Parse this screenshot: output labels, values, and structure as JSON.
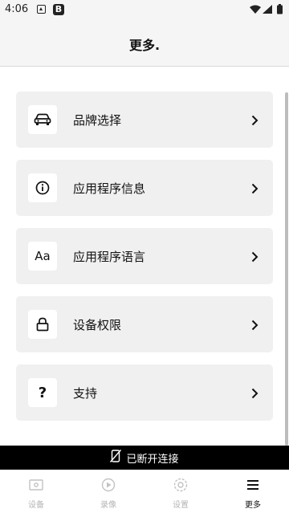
{
  "status_bar": {
    "time": "4:06",
    "notification_badge": "B"
  },
  "header": {
    "title": "更多."
  },
  "menu": [
    {
      "label": "品牌选择",
      "icon": "car-icon"
    },
    {
      "label": "应用程序信息",
      "icon": "info-icon"
    },
    {
      "label": "应用程序语言",
      "icon": "font-icon",
      "icon_text": "Aa"
    },
    {
      "label": "设备权限",
      "icon": "lock-icon"
    },
    {
      "label": "支持",
      "icon": "help-icon",
      "icon_text": "?"
    }
  ],
  "banner": {
    "text": "已断开连接",
    "icon": "no-phone-icon"
  },
  "bottom_nav": [
    {
      "label": "设备",
      "icon": "device-icon",
      "active": false
    },
    {
      "label": "录像",
      "icon": "play-icon",
      "active": false
    },
    {
      "label": "设置",
      "icon": "gear-icon",
      "active": false
    },
    {
      "label": "更多",
      "icon": "menu-icon",
      "active": true
    }
  ],
  "colors": {
    "accent": "#000000",
    "card_bg": "#f0f0f0",
    "inactive": "#b5b5b5"
  }
}
